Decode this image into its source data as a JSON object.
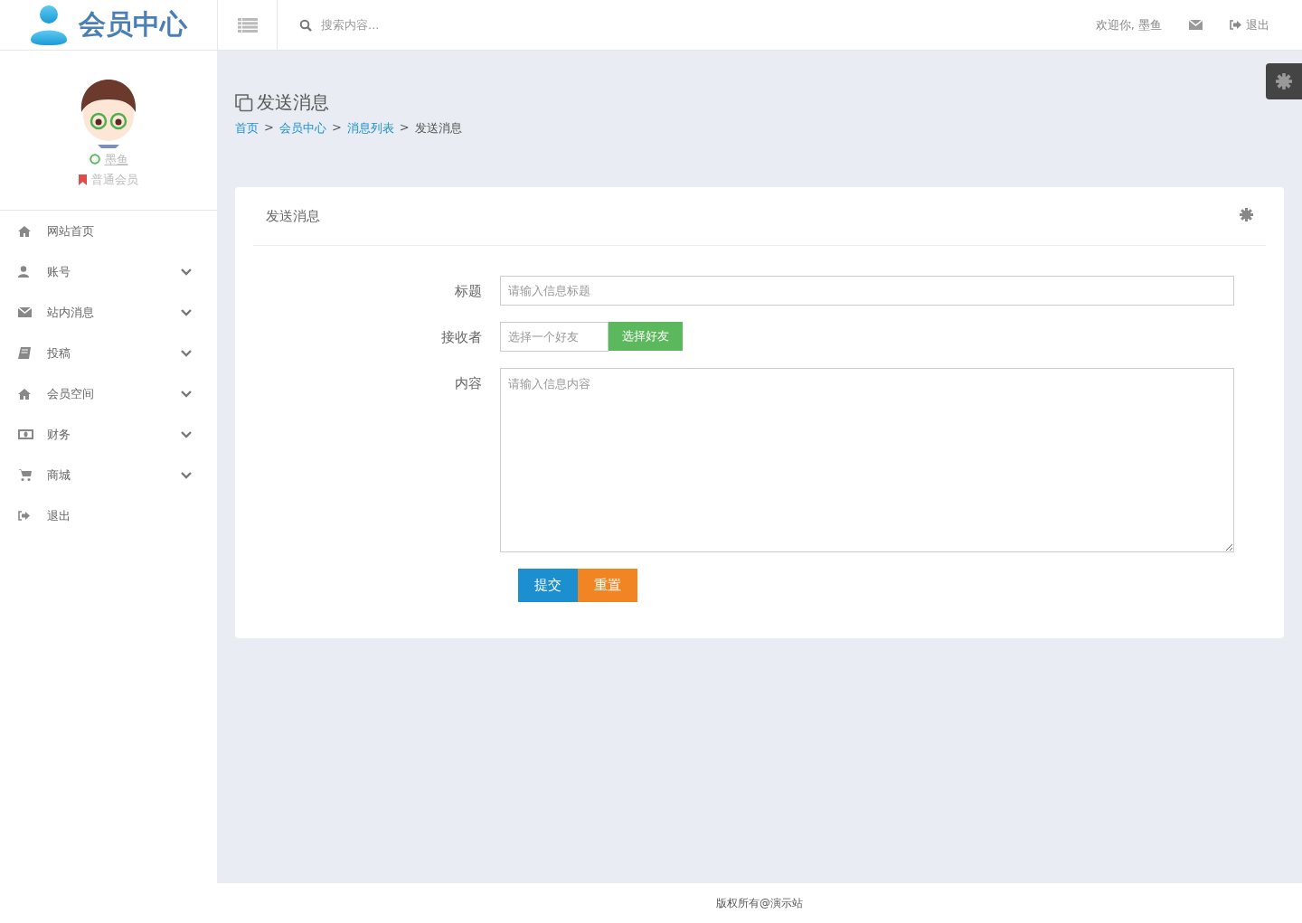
{
  "header": {
    "logo": "会员中心",
    "search": {
      "placeholder": "搜索内容..."
    },
    "welcome": "欢迎你, 墨鱼",
    "logout": "退出"
  },
  "sidebar": {
    "user": {
      "name": "墨鱼",
      "online": true,
      "role": "普通会员"
    },
    "items": [
      {
        "label": "网站首页",
        "expandable": false
      },
      {
        "label": "账号",
        "expandable": true
      },
      {
        "label": "站内消息",
        "expandable": true
      },
      {
        "label": "投稿",
        "expandable": true
      },
      {
        "label": "会员空间",
        "expandable": true
      },
      {
        "label": "财务",
        "expandable": true
      },
      {
        "label": "商城",
        "expandable": true
      },
      {
        "label": "退出",
        "expandable": false
      }
    ]
  },
  "page": {
    "title": "发送消息",
    "breadcrumb": [
      {
        "label": "首页",
        "kind": "link"
      },
      {
        "label": ">",
        "kind": "separator"
      },
      {
        "label": "会员中心",
        "kind": "link"
      },
      {
        "label": ">",
        "kind": "separator"
      },
      {
        "label": "消息列表",
        "kind": "link"
      },
      {
        "label": ">",
        "kind": "separator"
      },
      {
        "label": "发送消息",
        "kind": "current"
      }
    ]
  },
  "card": {
    "title": "发送消息",
    "fields": [
      {
        "kind": "text",
        "label": "标题",
        "placeholder": "请输入信息标题"
      },
      {
        "kind": "picker",
        "label": "接收者",
        "placeholder": "选择一个好友",
        "button": "选择好友"
      },
      {
        "kind": "textarea",
        "label": "内容",
        "placeholder": "请输入信息内容"
      }
    ],
    "buttons": [
      {
        "label": "提交",
        "color": "#1b8fd0"
      },
      {
        "label": "重置",
        "color": "#f28523"
      }
    ]
  },
  "footer": "版权所有@演示站"
}
